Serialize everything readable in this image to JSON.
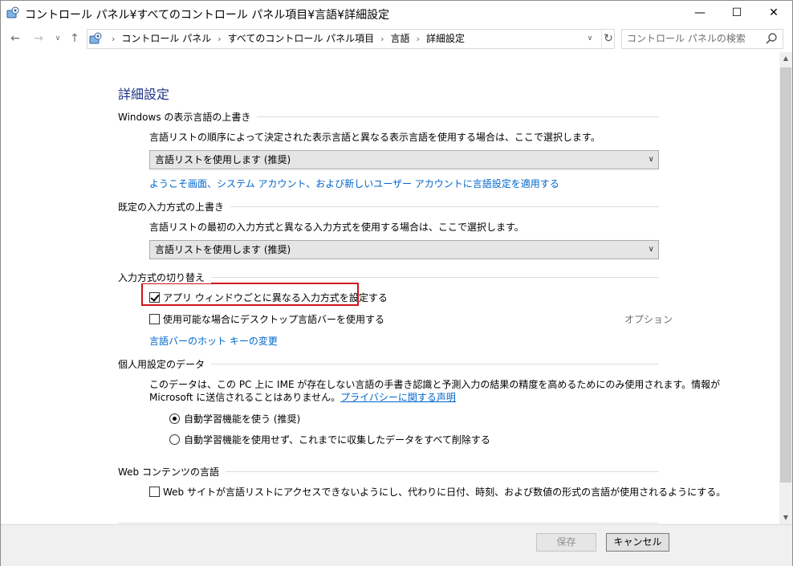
{
  "window": {
    "title": "コントロール パネル¥すべてのコントロール パネル項目¥言語¥詳細設定",
    "icon": "control-panel-icon"
  },
  "nav": {
    "breadcrumbs": [
      "コントロール パネル",
      "すべてのコントロール パネル項目",
      "言語",
      "詳細設定"
    ],
    "search_placeholder": "コントロール パネルの検索"
  },
  "page": {
    "title": "詳細設定",
    "display_language": {
      "heading": "Windows の表示言語の上書き",
      "description": "言語リストの順序によって決定された表示言語と異なる表示言語を使用する場合は、ここで選択します。",
      "selected": "言語リストを使用します (推奨)",
      "apply_link": "ようこそ画面、システム アカウント、および新しいユーザー アカウントに言語設定を適用する"
    },
    "input_method": {
      "heading": "既定の入力方式の上書き",
      "description": "言語リストの最初の入力方式と異なる入力方式を使用する場合は、ここで選択します。",
      "selected": "言語リストを使用します (推奨)"
    },
    "switching": {
      "heading": "入力方式の切り替え",
      "per_app_label": "アプリ ウィンドウごとに異なる入力方式を設定する",
      "per_app_checked": true,
      "desktop_bar_label": "使用可能な場合にデスクトップ言語バーを使用する",
      "desktop_bar_checked": false,
      "options_label": "オプション",
      "hotkey_link": "言語バーのホット キーの変更"
    },
    "personalization": {
      "heading": "個人用設定のデータ",
      "description_line1": "このデータは、この PC 上に IME が存在しない言語の手書き認識と予測入力の結果の精度を高めるためにのみ使用されます。情報が",
      "description_line2": "Microsoft に送信されることはありません。",
      "privacy_link": "プライバシーに関する声明",
      "option_use": "自動学習機能を使う (推奨)",
      "option_delete": "自動学習機能を使用せず、これまでに収集したデータをすべて削除する",
      "selected_option": "use"
    },
    "web_content": {
      "heading": "Web コンテンツの言語",
      "checkbox_label": "Web サイトが言語リストにアクセスできないようにし、代わりに日付、時刻、および数値の形式の言語が使用されるようにする。",
      "checked": false
    }
  },
  "footer": {
    "save_label": "保存",
    "cancel_label": "キャンセル"
  },
  "colors": {
    "title_blue": "#1e3287",
    "link_blue": "#0066cc",
    "highlight_red": "#d0141c"
  }
}
